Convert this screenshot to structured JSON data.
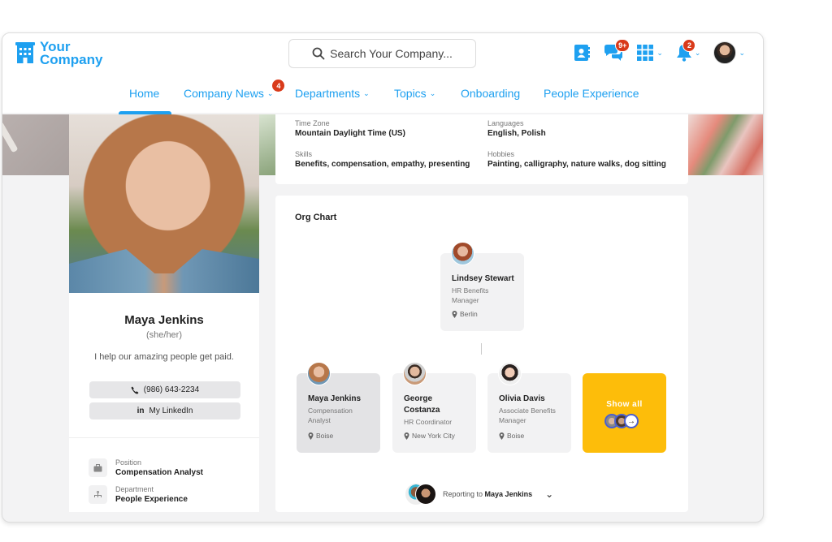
{
  "brand": {
    "line1": "Your",
    "line2": "Company",
    "color": "#1ea0f0"
  },
  "search": {
    "placeholder": "Search Your Company..."
  },
  "header_icons": {
    "directory": "contacts-book-icon",
    "chat": {
      "icon": "chat-bubbles-icon",
      "badge": "9+"
    },
    "apps": {
      "icon": "app-grid-icon"
    },
    "notifications": {
      "icon": "bell-icon",
      "badge": "2"
    },
    "profile": {
      "icon": "user-avatar"
    }
  },
  "nav": {
    "items": [
      {
        "label": "Home",
        "active": true
      },
      {
        "label": "Company News",
        "dropdown": true,
        "badge": "4"
      },
      {
        "label": "Departments",
        "dropdown": true
      },
      {
        "label": "Topics",
        "dropdown": true
      },
      {
        "label": "Onboarding"
      },
      {
        "label": "People Experience"
      }
    ]
  },
  "profile": {
    "name": "Maya Jenkins",
    "pronouns": "(she/her)",
    "bio": "I help our amazing people get paid.",
    "phone": "(986) 643-2234",
    "linkedin": "My LinkedIn",
    "linkedin_icon": "in",
    "position_label": "Position",
    "position": "Compensation Analyst",
    "department_label": "Department",
    "department": "People Experience"
  },
  "details": {
    "timezone_label": "Time Zone",
    "timezone": "Mountain Daylight Time (US)",
    "languages_label": "Languages",
    "languages": "English, Polish",
    "skills_label": "Skills",
    "skills": "Benefits, compensation, empathy, presenting",
    "hobbies_label": "Hobbies",
    "hobbies": "Painting, calligraphy, nature walks, dog sitting"
  },
  "org_chart": {
    "title": "Org Chart",
    "manager": {
      "name": "Lindsey Stewart",
      "title": "HR Benefits Manager",
      "location": "Berlin"
    },
    "peers": [
      {
        "name": "Maya Jenkins",
        "title": "Compensation Analyst",
        "location": "Boise",
        "selected": true
      },
      {
        "name": "George Costanza",
        "title": "HR Coordinator",
        "location": "New York City"
      },
      {
        "name": "Olivia Davis",
        "title": "Associate Benefits Manager",
        "location": "Boise"
      }
    ],
    "show_all": {
      "label": "Show all",
      "color": "#fdbd0a",
      "arrow": "→"
    },
    "reporting": {
      "prefix": "Reporting to",
      "name": "Maya Jenkins",
      "chevron": "⌄"
    }
  }
}
